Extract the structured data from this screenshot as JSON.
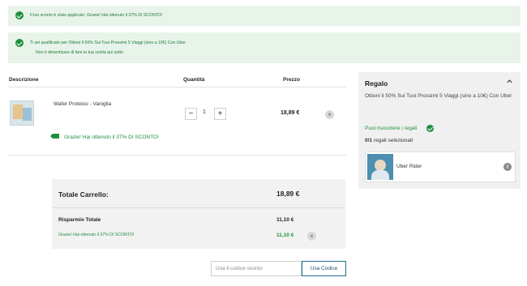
{
  "alerts": [
    {
      "message": "Il tuo sconto è stato applicato: Grazie! Hai ottenuto il 37% DI SCONTO!"
    },
    {
      "message": "Ti sei qualificato per Ottieni il 50% Sui Tuoi Prossimi 5 Viaggi (sino a 10€) Con Uber",
      "sub": "Non ti dimenticare di fare la tua scelta qui sotto"
    }
  ],
  "cart": {
    "headers": {
      "description": "Descrizione",
      "quantity": "Quantità",
      "price": "Prezzo"
    },
    "items": [
      {
        "name": "Wafer Proteico - Vaniglia",
        "quantity": "1",
        "price": "18,89 €",
        "discount_note": "Grazie! Hai ottenuto il 37% DI SCONTO!"
      }
    ],
    "qty_minus": "−",
    "qty_plus": "+",
    "remove_icon": "×"
  },
  "totals": {
    "total_label": "Totale Carrello:",
    "total_value": "18,89 €",
    "savings_label": "Risparmio Totale",
    "savings_value": "11,10 €",
    "discount_line_label": "Grazie! Hai ottenuto il 37% DI SCONTO!",
    "discount_line_value": "11,10 €"
  },
  "coupon": {
    "placeholder": "Usa il codice sconto",
    "button": "Usa Codice"
  },
  "gift": {
    "title": "Regalo",
    "description": "Ottieni il 50% Sui Tuoi Prossimi 5 Viaggi (sino a 10€) Con Uber",
    "claim": "Puoi riscuotere i regali",
    "count_bold": "0/1",
    "count_rest": " regali selezionati",
    "option_name": "Uber Rider",
    "info_icon": "i"
  },
  "colors": {
    "success": "#1f8f3c",
    "alert_bg": "#e8f3ea",
    "panel_bg": "#f0f0f0"
  }
}
